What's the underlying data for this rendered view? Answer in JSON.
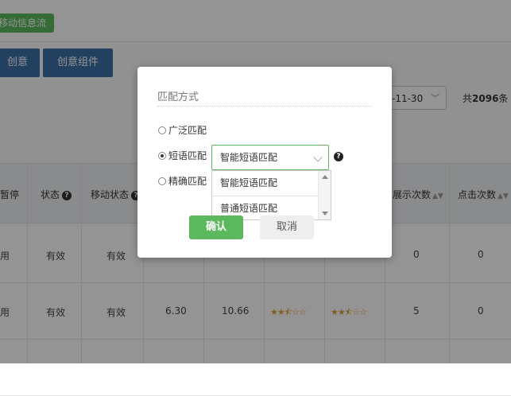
{
  "background": {
    "mobile_tag": "移动信息流",
    "buttons": [
      "创意",
      "创意组件"
    ],
    "date_range": "-11-30",
    "total_prefix": "共",
    "total_count": "2096",
    "total_suffix": "条",
    "headers": {
      "pause": "暂停",
      "status": "状态",
      "mobile_status": "移动状态",
      "impressions": "展示次数",
      "clicks": "点击次数"
    },
    "rows": [
      {
        "enable": "用",
        "status": "有效",
        "mobile_status": "有效",
        "cpc": "",
        "cost": "",
        "quality": "",
        "mobile_quality": "",
        "impressions": "0",
        "clicks": "0"
      },
      {
        "enable": "用",
        "status": "有效",
        "mobile_status": "有效",
        "cpc": "6.30",
        "cost": "10.66",
        "quality": "★★⯪☆☆",
        "mobile_quality": "★★⯪☆☆",
        "impressions": "5",
        "clicks": "0"
      }
    ]
  },
  "modal": {
    "title": "匹配方式",
    "options": {
      "broad": "广泛匹配",
      "phrase": "短语匹配",
      "exact": "精确匹配"
    },
    "selected_option": "phrase",
    "select_value": "智能短语匹配",
    "dropdown_options": [
      "智能短语匹配",
      "普通短语匹配"
    ],
    "confirm_label": "确认",
    "cancel_label": "取消",
    "help_icon": "question-circle-icon"
  }
}
